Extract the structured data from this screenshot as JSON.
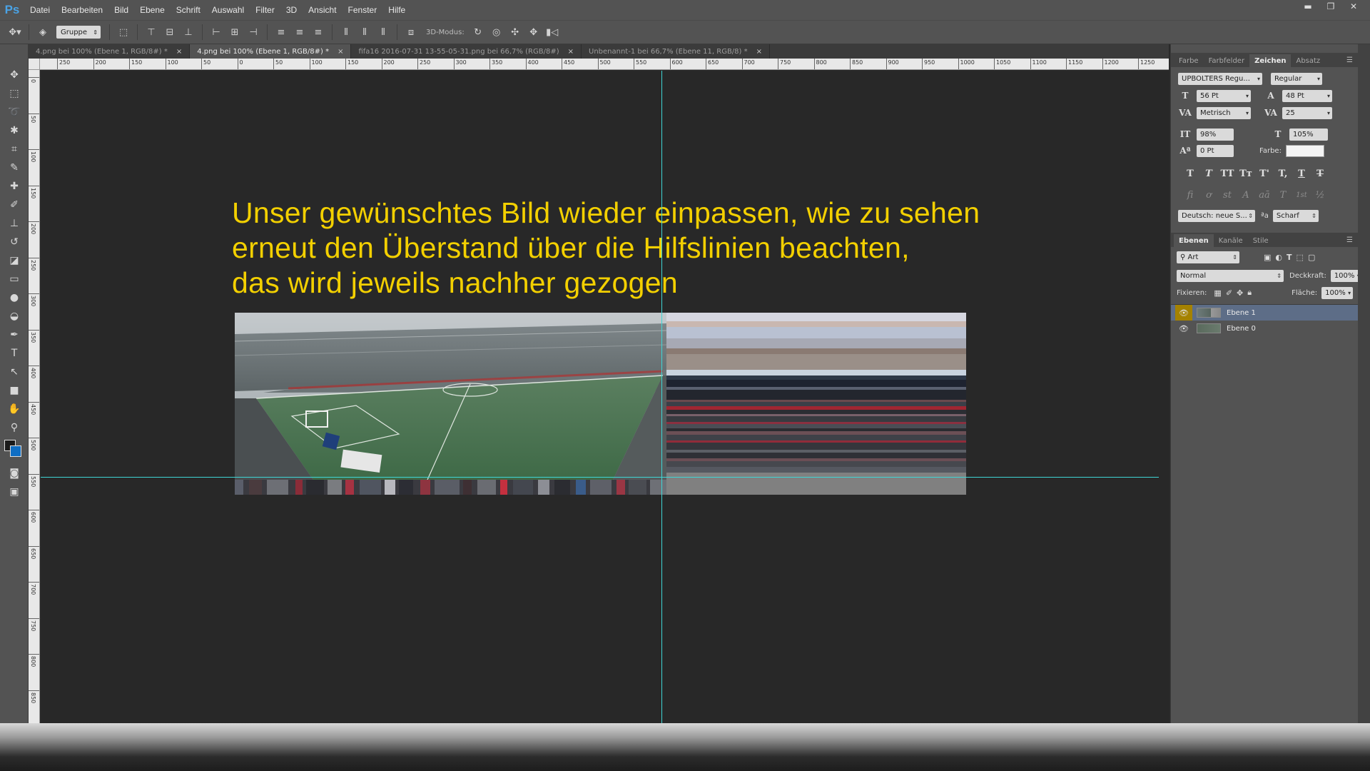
{
  "app": {
    "logo": "Ps"
  },
  "menu": [
    "Datei",
    "Bearbeiten",
    "Bild",
    "Ebene",
    "Schrift",
    "Auswahl",
    "Filter",
    "3D",
    "Ansicht",
    "Fenster",
    "Hilfe"
  ],
  "window_controls": {
    "minimize": "▬",
    "restore": "❐",
    "close": "✕"
  },
  "options": {
    "auto_select_value": "Gruppe",
    "mode3d_label": "3D-Modus:"
  },
  "tabs": [
    {
      "label": "4.png bei 100% (Ebene 1, RGB/8#) *"
    },
    {
      "label": "4.png bei 100% (Ebene 1, RGB/8#) *"
    },
    {
      "label": "fifa16 2016-07-31 13-55-05-31.png bei 66,7% (RGB/8#)"
    },
    {
      "label": "Unbenannt-1 bei 66,7% (Ebene 11, RGB/8) *"
    }
  ],
  "active_tab_index": 1,
  "ruler_top_labels": [
    "250",
    "200",
    "150",
    "100",
    "50",
    "0",
    "50",
    "100",
    "150",
    "200",
    "250",
    "300",
    "350",
    "400",
    "450",
    "500",
    "550",
    "600",
    "650",
    "700",
    "750",
    "800",
    "850",
    "900",
    "950",
    "1000",
    "1050",
    "1100",
    "1150",
    "1200",
    "1250"
  ],
  "ruler_left_labels": [
    "0",
    "50",
    "100",
    "150",
    "200",
    "250",
    "300",
    "350",
    "400",
    "450",
    "500",
    "550",
    "600",
    "650",
    "700",
    "750",
    "800",
    "850"
  ],
  "canvas_text": [
    "Unser gewünschtes Bild wieder einpassen, wie zu sehen",
    "erneut den Überstand über die Hilfslinien beachten,",
    "das wird jeweils nachher gezogen"
  ],
  "colors": {
    "overlay_text": "#f3d000",
    "guide": "#3fd6d6",
    "foreground": "#1b1b1b",
    "background": "#0f6ec4"
  },
  "character_panel": {
    "tabs": [
      "Farbe",
      "Farbfelder",
      "Zeichen",
      "Absatz"
    ],
    "active_tab": "Zeichen",
    "font_family": "UPBOLTERS Regu...",
    "font_style": "Regular",
    "font_size": "56 Pt",
    "leading": "48 Pt",
    "kerning": "Metrisch",
    "tracking": "25",
    "vertical_scale": "98%",
    "horizontal_scale": "105%",
    "baseline_shift": "0 Pt",
    "color_label": "Farbe:",
    "language": "Deutsch: neue S...",
    "aa_label": "ªa",
    "antialias": "Scharf",
    "style_buttons": [
      "T",
      "T",
      "TT",
      "Tт",
      "T'",
      "T,",
      "T",
      "T"
    ],
    "opentype_buttons": [
      "ﬁ",
      "ơ",
      "st",
      "A",
      "aā",
      "T",
      "1st",
      "½"
    ]
  },
  "layers_panel": {
    "tabs": [
      "Ebenen",
      "Kanäle",
      "Stile"
    ],
    "active_tab": "Ebenen",
    "filter_kind": "Art",
    "blend_mode": "Normal",
    "opacity_label": "Deckkraft:",
    "opacity": "100%",
    "lock_label": "Fixieren:",
    "fill_label": "Fläche:",
    "fill": "100%",
    "layers": [
      {
        "name": "Ebene 1",
        "selected": true
      },
      {
        "name": "Ebene 0",
        "selected": false
      }
    ]
  }
}
